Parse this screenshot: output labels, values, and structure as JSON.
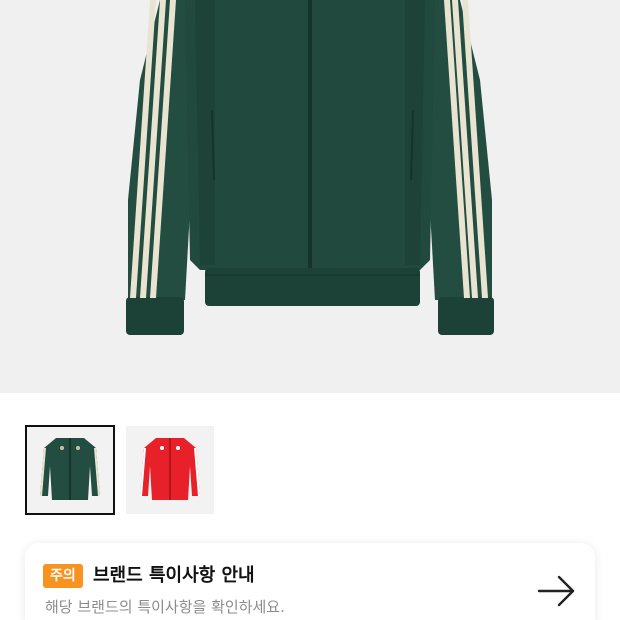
{
  "product": {
    "main_image": "green-track-jacket",
    "thumbnails": [
      {
        "name": "green-track-jacket",
        "color": "#1f4a3f",
        "selected": true
      },
      {
        "name": "red-track-jacket",
        "color": "#e8202a",
        "selected": false
      }
    ]
  },
  "notice": {
    "badge": "주의",
    "title": "브랜드 특이사항 안내",
    "subtitle": "해당 브랜드의 특이사항을 확인하세요.",
    "arrow_icon": "arrow-right-icon",
    "badge_color": "#f7931e"
  }
}
